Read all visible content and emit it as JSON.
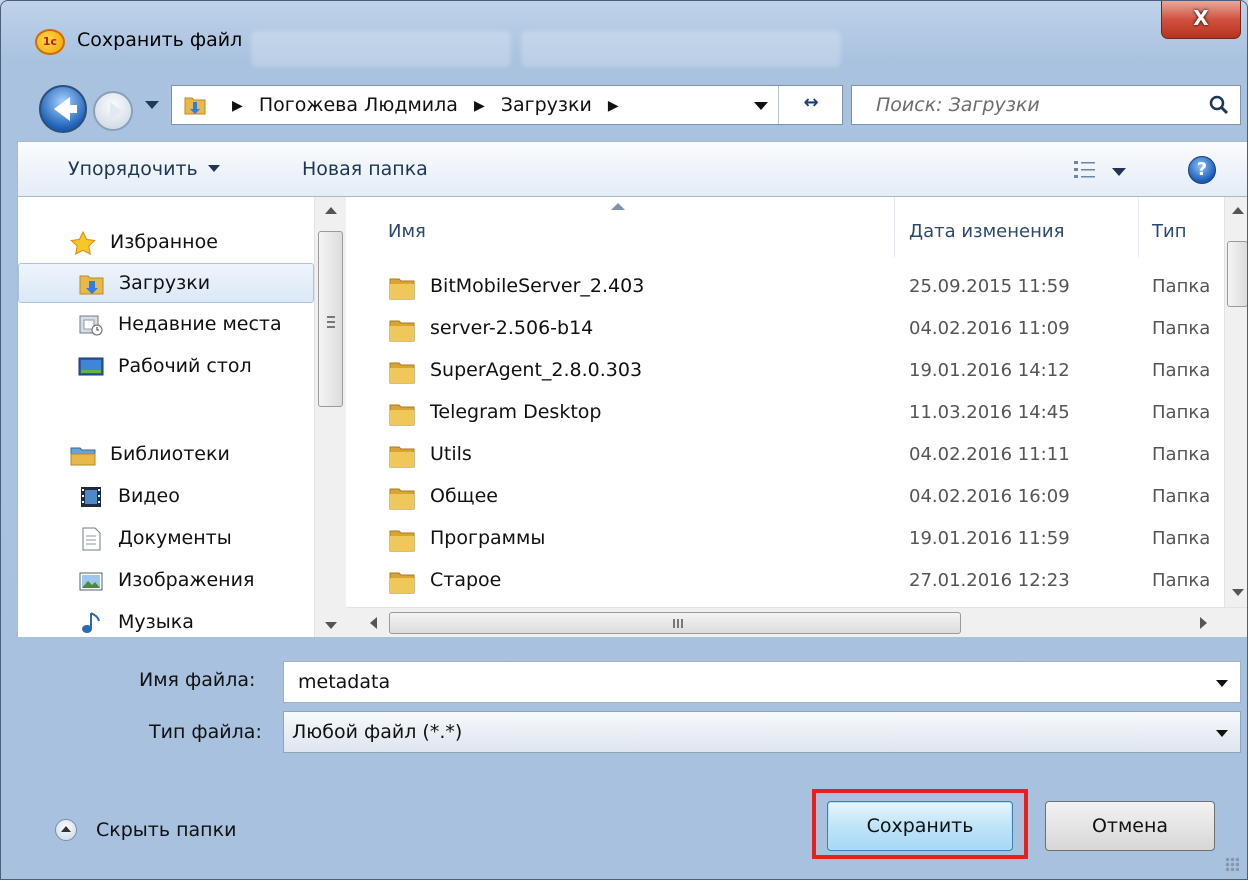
{
  "window": {
    "title": "Сохранить файл",
    "close_label": "X",
    "app_icon": "1c-logo-icon"
  },
  "navigation": {
    "breadcrumbs": [
      "Погожева Людмила",
      "Загрузки"
    ],
    "search_placeholder": "Поиск: Загрузки"
  },
  "toolbar": {
    "organize_label": "Упорядочить",
    "new_folder_label": "Новая папка",
    "help_label": "?"
  },
  "sidebar": {
    "favorites_header": "Избранное",
    "favorites": [
      {
        "label": "Загрузки",
        "icon": "downloads-folder-icon",
        "selected": true
      },
      {
        "label": "Недавние места",
        "icon": "recent-places-icon"
      },
      {
        "label": "Рабочий стол",
        "icon": "desktop-icon"
      }
    ],
    "libraries_header": "Библиотеки",
    "libraries": [
      {
        "label": "Видео",
        "icon": "video-icon"
      },
      {
        "label": "Документы",
        "icon": "documents-icon"
      },
      {
        "label": "Изображения",
        "icon": "pictures-icon"
      },
      {
        "label": "Музыка",
        "icon": "music-icon"
      }
    ]
  },
  "file_list": {
    "columns": [
      "Имя",
      "Дата изменения",
      "Тип"
    ],
    "rows": [
      {
        "name": "BitMobileServer_2.403",
        "date": "25.09.2015 11:59",
        "type": "Папка"
      },
      {
        "name": "server-2.506-b14",
        "date": "04.02.2016 11:09",
        "type": "Папка"
      },
      {
        "name": "SuperAgent_2.8.0.303",
        "date": "19.01.2016 14:12",
        "type": "Папка"
      },
      {
        "name": "Telegram Desktop",
        "date": "11.03.2016 14:45",
        "type": "Папка"
      },
      {
        "name": "Utils",
        "date": "04.02.2016 11:11",
        "type": "Папка"
      },
      {
        "name": "Общее",
        "date": "04.02.2016 16:09",
        "type": "Папка"
      },
      {
        "name": "Программы",
        "date": "19.01.2016 11:59",
        "type": "Папка"
      },
      {
        "name": "Старое",
        "date": "27.01.2016 12:23",
        "type": "Папка"
      }
    ]
  },
  "form": {
    "filename_label": "Имя файла:",
    "filename_value": "metadata",
    "filetype_label": "Тип файла:",
    "filetype_value": "Любой файл (*.*)"
  },
  "footer": {
    "hide_folders_label": "Скрыть папки",
    "save_label": "Сохранить",
    "cancel_label": "Отмена"
  },
  "colors": {
    "highlight": "#e8201c",
    "title_bar": "#bfd3ea",
    "close_button": "#d0523e",
    "folder": "#e8b84a"
  }
}
